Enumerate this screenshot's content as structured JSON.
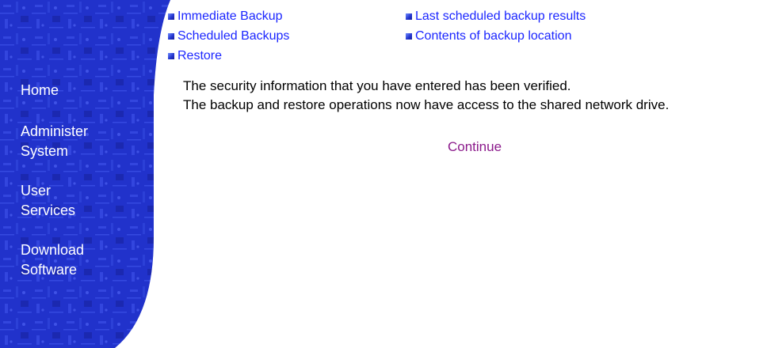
{
  "sidebar": {
    "items": [
      {
        "label_lines": [
          "Home"
        ]
      },
      {
        "label_lines": [
          "Administer",
          "System"
        ]
      },
      {
        "label_lines": [
          "User",
          "Services"
        ]
      },
      {
        "label_lines": [
          "Download",
          "Software"
        ]
      }
    ]
  },
  "top_links": {
    "immediate_backup": "Immediate Backup",
    "scheduled_backups": "Scheduled Backups",
    "restore": "Restore",
    "last_scheduled_results": "Last scheduled backup results",
    "contents_backup_location": "Contents of backup location"
  },
  "message": {
    "line1": "The security information that you have entered has been verified.",
    "line2": "The backup and restore operations now have access to the shared network drive."
  },
  "continue_label": "Continue",
  "colors": {
    "sidebar_blue": "#1f2fc8",
    "link_blue": "#1b26ff",
    "visited_purple": "#8b1a8b"
  }
}
